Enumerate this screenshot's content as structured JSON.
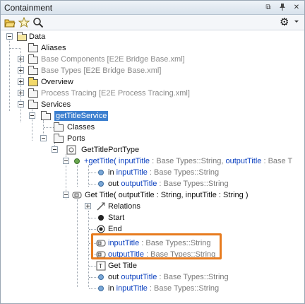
{
  "window": {
    "title": "Containment"
  },
  "title_buttons": {
    "restore": "⧉",
    "pin": "📌",
    "close": "✕"
  },
  "toolbar": {
    "icons": [
      "open-folder-icon",
      "star-icon",
      "search-icon"
    ],
    "settings": "⚙"
  },
  "tree": {
    "data": "Data",
    "aliases": "Aliases",
    "base_components": "Base Components [E2E Bridge Base.xml]",
    "base_types": "Base Types [E2E Bridge Base.xml]",
    "overview": "Overview",
    "process_tracing": "Process Tracing [E2E Process Tracing.xml]",
    "services": "Services",
    "get_title_service": "getTitleService",
    "classes": "Classes",
    "ports": "Ports",
    "get_title_port_type": "GetTitlePortType",
    "op_prefix": "+getTitle( ",
    "op_p1": "inputTitle",
    "op_t1": " : Base Types::String, ",
    "op_p2": "outputTitle",
    "op_t2": " : Base T",
    "in_label": "in ",
    "in_name": "inputTitle",
    "in_type": " : Base Types::String",
    "out_label": "out ",
    "out_name": "outputTitle",
    "out_type": " : Base Types::String",
    "activity": "Get Title( outputTitle : String, inputTitle : String )",
    "relations": "Relations",
    "start": "Start",
    "end": "End",
    "pin1_name": "inputTitle",
    "pin1_type": " : Base Types::String",
    "pin2_name": "outputTitle",
    "pin2_type": " : Base Types::String",
    "get_title_action": "Get Title",
    "a_out_label": "out ",
    "a_out_name": "outputTitle",
    "a_out_type": " : Base Types::String",
    "a_in_label": "in ",
    "a_in_name": "inputTitle",
    "a_in_type": " : Base Types::String"
  }
}
